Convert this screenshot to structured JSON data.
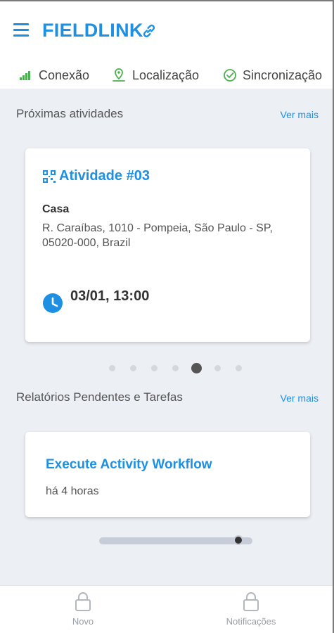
{
  "app": {
    "brand": "FIELDLINK"
  },
  "status": {
    "connection": "Conexão",
    "location": "Localização",
    "sync": "Sincronização"
  },
  "upcoming": {
    "title": "Próximas atividades",
    "see_more": "Ver mais",
    "card": {
      "title": "Atividade #03",
      "place": "Casa",
      "address": "R. Caraíbas, 1010 - Pompeia, São Paulo - SP, 05020-000, Brazil",
      "datetime": "03/01, 13:00"
    },
    "carousel_active_index": 4,
    "carousel_count": 7
  },
  "pending": {
    "title": "Relatórios Pendentes e Tarefas",
    "see_more": "Ver mais",
    "card": {
      "title": "Execute Activity Workflow",
      "time": "há 4 horas"
    }
  },
  "tabs": {
    "new": "Novo",
    "notifications": "Notificações"
  },
  "colors": {
    "accent": "#1e8fe1",
    "connection_ok": "#4caf50",
    "background": "#eceff4"
  },
  "icons": {
    "menu": "hamburger-icon",
    "brand": "link-icon",
    "connection": "signal-bars-icon",
    "location": "map-pin-icon",
    "sync": "check-circle-icon",
    "activity": "qr-code-icon",
    "time": "clock-icon",
    "new": "lock-icon",
    "notifications": "lock-icon"
  }
}
